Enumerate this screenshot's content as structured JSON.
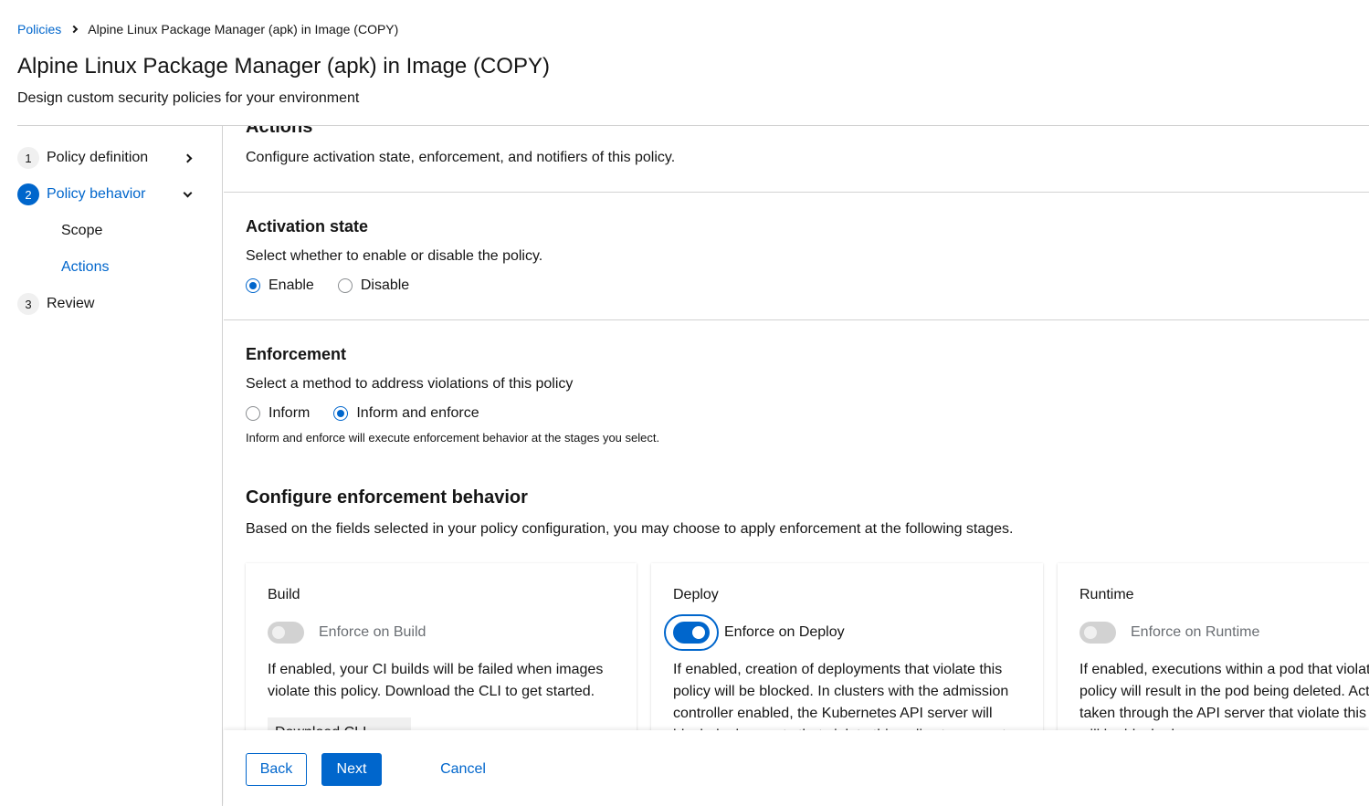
{
  "breadcrumb": {
    "parent": "Policies",
    "current": "Alpine Linux Package Manager (apk) in Image (COPY)"
  },
  "header": {
    "title": "Alpine Linux Package Manager (apk) in Image (COPY)",
    "subtitle": "Design custom security policies for your environment"
  },
  "nav": {
    "steps": [
      {
        "number": "1",
        "label": "Policy definition"
      },
      {
        "number": "2",
        "label": "Policy behavior"
      },
      {
        "number": "3",
        "label": "Review"
      }
    ],
    "substeps": [
      {
        "label": "Scope"
      },
      {
        "label": "Actions"
      }
    ],
    "active_step": "2",
    "active_substep": "Actions"
  },
  "actions": {
    "heading": "Actions",
    "description": "Configure activation state, enforcement, and notifiers of this policy."
  },
  "activation": {
    "heading": "Activation state",
    "description": "Select whether to enable or disable the policy.",
    "options": [
      {
        "label": "Enable",
        "checked": true
      },
      {
        "label": "Disable",
        "checked": false
      }
    ]
  },
  "enforcement": {
    "heading": "Enforcement",
    "description": "Select a method to address violations of this policy",
    "options": [
      {
        "label": "Inform",
        "checked": false
      },
      {
        "label": "Inform and enforce",
        "checked": true
      }
    ],
    "helper": "Inform and enforce will execute enforcement behavior at the stages you select."
  },
  "behavior": {
    "heading": "Configure enforcement behavior",
    "description": "Based on the fields selected in your policy configuration, you may choose to apply enforcement at the following stages.",
    "cards": [
      {
        "title": "Build",
        "switch_label": "Enforce on Build",
        "enabled": false,
        "text": "If enabled, your CI builds will be failed when images violate this policy. Download the CLI to get started.",
        "button": "Download CLI"
      },
      {
        "title": "Deploy",
        "switch_label": "Enforce on Deploy",
        "enabled": true,
        "text": "If enabled, creation of deployments that violate this policy will be blocked. In clusters with the admission controller enabled, the Kubernetes API server will block deployments that violate this policy to prevent"
      },
      {
        "title": "Runtime",
        "switch_label": "Enforce on Runtime",
        "enabled": false,
        "text": "If enabled, executions within a pod that violate this policy will result in the pod being deleted. Actions taken through the API server that violate this policy will be blocked."
      }
    ]
  },
  "footer": {
    "back": "Back",
    "next": "Next",
    "cancel": "Cancel"
  },
  "colors": {
    "accent": "#0066cc",
    "border": "#d2d2d2",
    "muted": "#6a6e73"
  }
}
